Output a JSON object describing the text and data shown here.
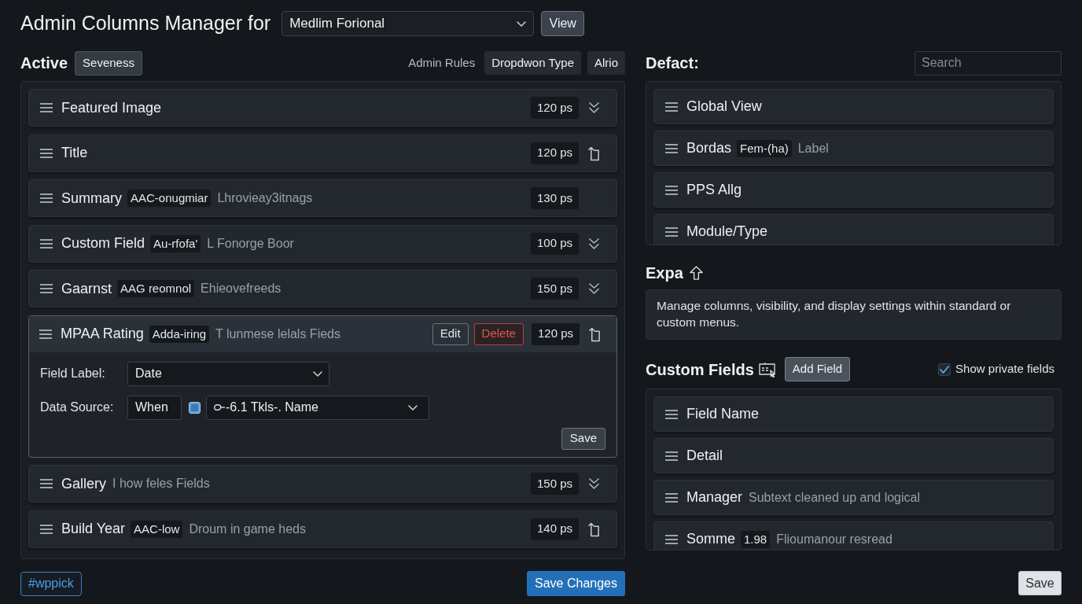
{
  "header": {
    "title": "Admin Columns Manager for",
    "dropdown": "Medlim Forional",
    "view_button": "View"
  },
  "active": {
    "heading": "Active",
    "tag_button": "Seveness",
    "toolbar": [
      {
        "kind": "text",
        "label": "Admin Rules"
      },
      {
        "kind": "button",
        "label": "Dropdwon Type"
      },
      {
        "kind": "button",
        "label": "Alrio"
      }
    ],
    "columns": [
      {
        "name": "Featured Image",
        "kind": "collapsible",
        "width": "120 ps",
        "expanded": false
      },
      {
        "name": "Title",
        "kind": "linked",
        "width": "120 ps",
        "expanded": false
      },
      {
        "name": "Summary",
        "badge": "AAC-onugmiar",
        "subtext": "Lhrovieay3itnags",
        "kind": "plain",
        "width": "130 ps",
        "expanded": false
      },
      {
        "name": "Custom Field",
        "badge": "Au-rfofa'",
        "subtext": "L Fonorge Boor",
        "kind": "collapsible",
        "width": "100 ps",
        "expanded": false
      },
      {
        "name": "Gaarnst",
        "badge": "AAG reomnol",
        "subtext": "Ehieovefreeds",
        "kind": "collapsible",
        "width": "150 ps",
        "expanded": false
      },
      {
        "name": "MPAA Rating",
        "badge": "Adda-iring",
        "subtext": "T lunmese lelals Fieds",
        "kind": "linked",
        "width": "120 ps",
        "expanded": true,
        "actions": [
          {
            "kind": "default",
            "label": "Edit"
          },
          {
            "kind": "danger",
            "label": "Delete"
          }
        ],
        "editor": {
          "fields": [
            {
              "kind": "select",
              "label": "Field Label:",
              "value": "Date"
            },
            {
              "kind": "source",
              "label": "Data Source:",
              "value": "When",
              "checked": true,
              "option": "-6.1 Tkls-. Name"
            }
          ],
          "save": "Save"
        }
      },
      {
        "name": "Gallery",
        "subtext": "I how feles Fields",
        "kind": "collapsible",
        "width": "150 ps",
        "expanded": false
      },
      {
        "name": "Build Year",
        "badge": "AAC-low",
        "subtext": "Droum in game heds",
        "kind": "linked",
        "width": "140 ps",
        "expanded": false
      }
    ]
  },
  "defaults": {
    "heading": "Defact:",
    "search": {
      "placeholder": "Search"
    },
    "items": [
      {
        "name": "Global View"
      },
      {
        "name": "Bordas",
        "badge": "Fem-(ha)",
        "subtext": "Label"
      },
      {
        "name": "PPS Allg"
      },
      {
        "name": "Module/Type"
      }
    ]
  },
  "expa": {
    "heading": "Expa",
    "description": "Manage columns, visibility, and display settings within standard or custom menus."
  },
  "custom_fields": {
    "heading": "Custom Fields",
    "add_button": "Add Field",
    "show_private": {
      "label": "Show private fields",
      "checked": true
    },
    "items": [
      {
        "name": "Field Name"
      },
      {
        "name": "Detail"
      },
      {
        "name": "Manager",
        "subtext": "Subtext cleaned up and logical"
      },
      {
        "name": "Somme",
        "badge": "1.98",
        "subtext": "Flioumanour resread"
      }
    ]
  },
  "footer": {
    "tag_link": "#wppick",
    "save_changes": "Save Changes"
  },
  "save_button": "Save"
}
